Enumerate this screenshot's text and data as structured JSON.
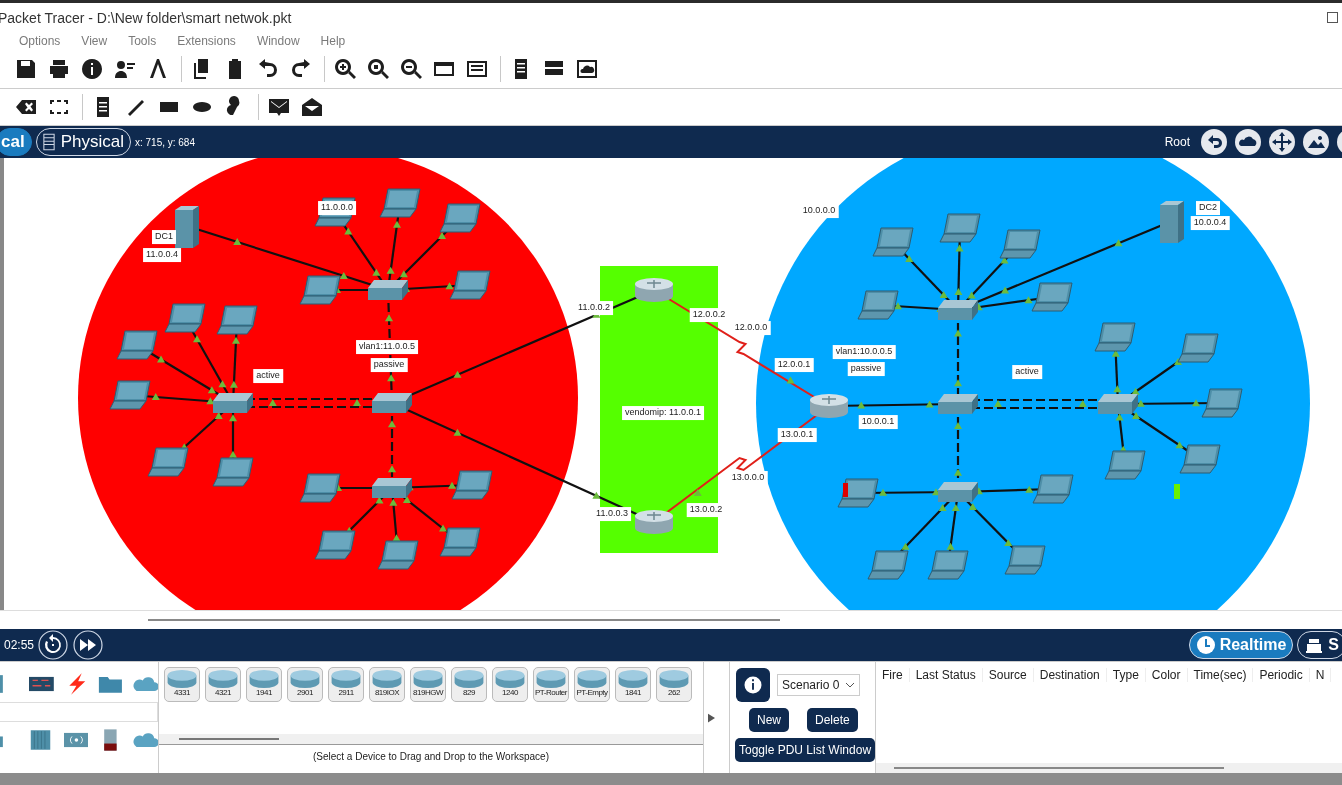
{
  "window": {
    "title": "Packet Tracer - D:\\New folder\\smart netwok.pkt"
  },
  "menu": [
    "Options",
    "View",
    "Tools",
    "Extensions",
    "Window",
    "Help"
  ],
  "view_tabs": [
    {
      "label": "cal",
      "selected": true
    },
    {
      "label": "Physical",
      "selected": false
    }
  ],
  "cursor_position": "x: 715, y: 684",
  "root_label": "Root",
  "diagram_labels": [
    "11.0.0.0",
    "DC1",
    "11.0.0.4",
    "vlan1:11.0.0.5",
    "passive",
    "active",
    "11.0.0.2",
    "11.0.0.3",
    "12.0.0.2",
    "12.0.0.0",
    "12.0.0.1",
    "vendomip: 11.0.0.1",
    "13.0.0.1",
    "13.0.0.0",
    "13.0.0.2",
    "10.0.0.0",
    "DC2",
    "10.0.0.4",
    "vlan1:10.0.0.5",
    "passive",
    "10.0.0.1",
    "active"
  ],
  "sim_bar": {
    "time": "02:55",
    "modes": [
      {
        "label": "Realtime",
        "selected": true
      },
      {
        "label": "S",
        "selected": false
      }
    ]
  },
  "device_models": [
    "4331",
    "4321",
    "1941",
    "2901",
    "2911",
    "819IOX",
    "819HGW",
    "829",
    "1240",
    "PT-Router",
    "PT-Empty",
    "1841",
    "262"
  ],
  "device_hint": "(Select a Device to Drag and Drop to the Workspace)",
  "scenario": {
    "value": "Scenario 0"
  },
  "pdu_buttons": [
    "New",
    "Delete",
    "Toggle PDU List Window"
  ],
  "pdu_columns": [
    "Fire",
    "Last Status",
    "Source",
    "Destination",
    "Type",
    "Color",
    "Time(sec)",
    "Periodic",
    "N"
  ]
}
